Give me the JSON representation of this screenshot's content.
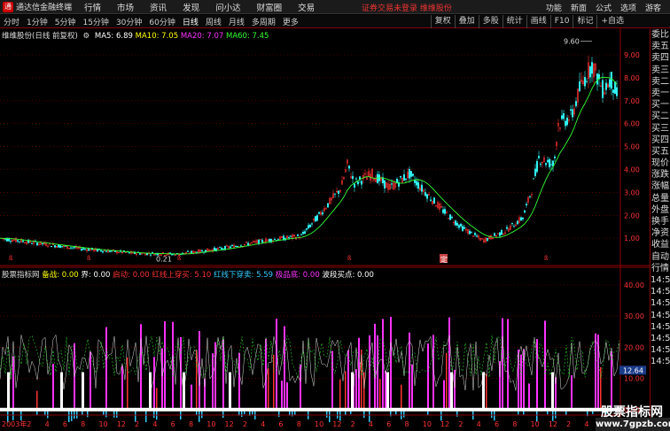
{
  "window": {
    "title": "通达信金融终端",
    "menus": [
      "行情",
      "市场",
      "资讯",
      "发现",
      "问小达",
      "财富圈",
      "交易"
    ],
    "banner": "证券交易未登录 维维股份",
    "right_menus": [
      "功能",
      "新面",
      "公式",
      "选项",
      "游客"
    ]
  },
  "toolbar": {
    "periods": [
      "分时",
      "1分钟",
      "5分钟",
      "15分钟",
      "30分钟",
      "60分钟",
      "日线",
      "周线",
      "月线",
      "多周期",
      "更多"
    ],
    "active_period": "日线",
    "buttons": [
      "复权",
      "叠加",
      "多股",
      "统计",
      "画线",
      "F10",
      "标记",
      "+自选"
    ]
  },
  "main_chart": {
    "title": "维维股份(日线 前复权)",
    "ma": [
      {
        "label": "MA5: 6.89",
        "color": "#ffffff"
      },
      {
        "label": "MA10: 7.05",
        "color": "#ffff00"
      },
      {
        "label": "MA20: 7.07",
        "color": "#ff33ff"
      },
      {
        "label": "MA60: 7.45",
        "color": "#33ff33"
      }
    ],
    "y_ticks": [
      "9.00",
      "8.00",
      "7.00",
      "6.00",
      "5.00",
      "4.00",
      "3.00",
      "2.00",
      "1.00"
    ],
    "high_label": "9.60",
    "low_label": "0.21",
    "marker": "定"
  },
  "indicator": {
    "name": "股票指标网",
    "fields": [
      {
        "label": "备战: 0.00",
        "color": "#ffff00"
      },
      {
        "label": "界: 0.00",
        "color": "#ffffff"
      },
      {
        "label": "启动: 0.00",
        "color": "#ff3333"
      },
      {
        "label": "红线上穿买: 5.10",
        "color": "#ff3333"
      },
      {
        "label": "红线下穿卖: 5.59",
        "color": "#33ccff"
      },
      {
        "label": "极品底: 0.00",
        "color": "#ff33ff"
      },
      {
        "label": "波段买点: 0.00",
        "color": "#ffffff"
      }
    ],
    "y_ticks": [
      "40.00",
      "30.00",
      "20.00",
      "10.00",
      "0.00"
    ],
    "current_value": "12.64"
  },
  "x_axis": {
    "labels": [
      "2003年",
      "2",
      "4",
      "6",
      "8",
      "10",
      "12",
      "2",
      "4",
      "6",
      "8",
      "10",
      "12",
      "2",
      "4",
      "6",
      "8",
      "10",
      "12",
      "2",
      "4",
      "6",
      "8",
      "10",
      "12",
      "2",
      "4",
      "6",
      "8",
      "10",
      "12",
      "2",
      "4",
      "6",
      "8"
    ]
  },
  "right_panel": {
    "items": [
      "委比",
      "卖五",
      "卖四",
      "卖三",
      "卖二",
      "卖一",
      "买一",
      "买二",
      "买三",
      "买四",
      "买五",
      "现价",
      "涨跌",
      "涨幅",
      "总量",
      "外盘",
      "换手",
      "净资",
      "收益",
      "自动",
      "行情",
      "14:50",
      "14:50",
      "14:50",
      "14:50",
      "14:50",
      "14:50",
      "14:50",
      "14:50"
    ]
  },
  "watermark": {
    "title": "股票指标网",
    "url": "www.7gpzb.com"
  },
  "colors": {
    "up": "#ff3333",
    "down": "#33ffff",
    "grid": "#8b0000",
    "ma60": "#33ff33"
  }
}
